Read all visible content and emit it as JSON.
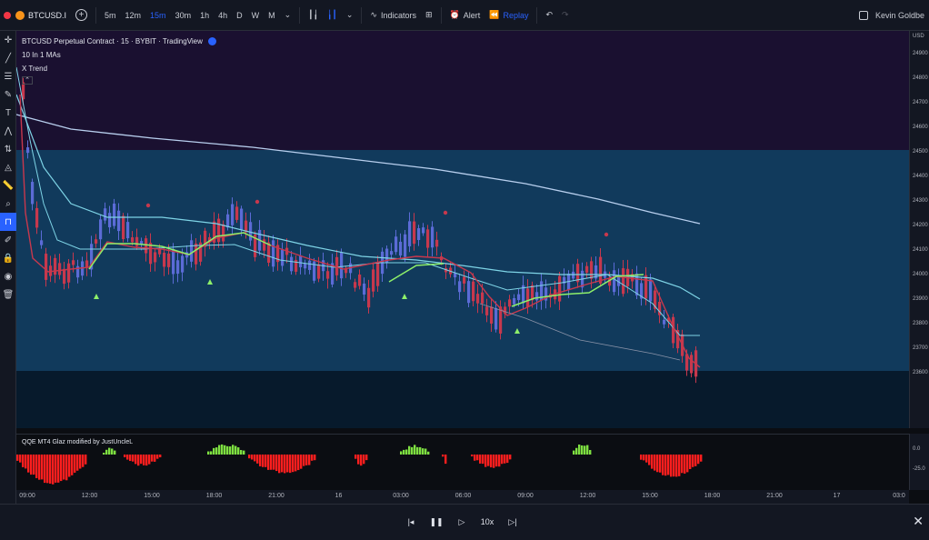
{
  "toolbar": {
    "symbol": "BTCUSD.I",
    "timeframes": [
      "5m",
      "12m",
      "15m",
      "30m",
      "1h",
      "4h",
      "D",
      "W",
      "M"
    ],
    "active_timeframe": "15m",
    "indicators_label": "Indicators",
    "alert_label": "Alert",
    "replay_label": "Replay",
    "user_name": "Kevin Goldbe"
  },
  "chart": {
    "title": "BTCUSD Perpetual Contract · 15 · BYBIT · TradingView",
    "indicator_1": "10 In 1 MAs",
    "indicator_2": "X Trend",
    "y_axis_header": "USD",
    "y_ticks": [
      "24900",
      "24800",
      "24700",
      "24600",
      "24500",
      "24400",
      "24300",
      "24200",
      "24100",
      "24000",
      "23900",
      "23800",
      "23700",
      "23600"
    ],
    "colors": {
      "up_candle": "#5b6bd6",
      "down_candle": "#c7384d",
      "trend_line": "#8ef06a",
      "ma_fast": "#7ed4e6",
      "ma_slow": "#b8cfee",
      "zone_top": "#1a1030",
      "zone_mid": "#113a5c"
    }
  },
  "oscillator": {
    "label": "QQE MT4 Glaz modified by JustUncleL",
    "y_ticks": [
      "0.0",
      "-25.0"
    ],
    "colors": {
      "positive": "#7ee041",
      "negative": "#ff1e1e"
    }
  },
  "x_axis": {
    "ticks": [
      "09:00",
      "12:00",
      "15:00",
      "18:00",
      "21:00",
      "16",
      "03:00",
      "06:00",
      "09:00",
      "12:00",
      "15:00",
      "18:00",
      "21:00",
      "17",
      "03:0"
    ]
  },
  "replay_bar": {
    "speed": "10x"
  }
}
